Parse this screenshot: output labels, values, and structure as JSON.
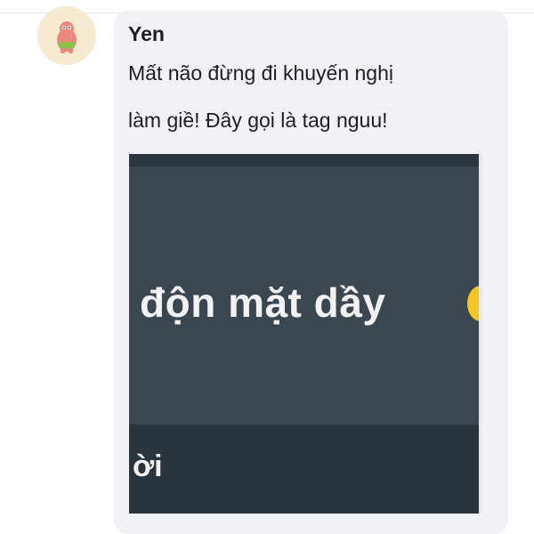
{
  "comment": {
    "author": "Yen",
    "text_lines": [
      "Mất não đừng đi khuyến nghị",
      "làm giề! Đây gọi là tag nguu!"
    ],
    "avatar_icon": "patrick-star-avatar-icon",
    "attached_image": {
      "caption": "độn mặt dầy",
      "lower_text": "ời",
      "emoji_icon": "emoji-face-icon"
    }
  },
  "colors": {
    "bubble": "#f0f2f5",
    "text": "#1c1e21",
    "image_bg": "#3a4650",
    "image_lower": "#2a343d"
  }
}
